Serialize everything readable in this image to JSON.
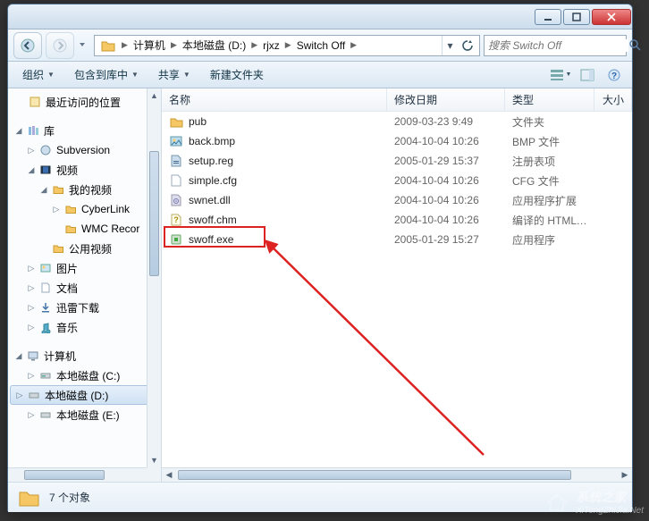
{
  "window": {
    "title": ""
  },
  "nav": {
    "crumbs": [
      "计算机",
      "本地磁盘 (D:)",
      "rjxz",
      "Switch Off"
    ],
    "search_placeholder": "搜索 Switch Off"
  },
  "toolbar": {
    "organize": "组织",
    "include": "包含到库中",
    "share": "共享",
    "newfolder": "新建文件夹"
  },
  "columns": {
    "name": "名称",
    "date": "修改日期",
    "type": "类型",
    "size": "大小"
  },
  "tree": {
    "recent": "最近访问的位置",
    "libraries": "库",
    "subversion": "Subversion",
    "video": "视频",
    "myvideo": "我的视频",
    "cyberlink": "CyberLink",
    "wmc": "WMC Recor",
    "publicvideo": "公用视频",
    "pictures": "图片",
    "documents": "文档",
    "xunlei": "迅雷下载",
    "music": "音乐",
    "computer": "计算机",
    "drive_c": "本地磁盘 (C:)",
    "drive_d": "本地磁盘 (D:)",
    "drive_e": "本地磁盘 (E:)"
  },
  "files": [
    {
      "name": "pub",
      "date": "2009-03-23 9:49",
      "type": "文件夹",
      "icon": "folder"
    },
    {
      "name": "back.bmp",
      "date": "2004-10-04 10:26",
      "type": "BMP 文件",
      "icon": "img"
    },
    {
      "name": "setup.reg",
      "date": "2005-01-29 15:37",
      "type": "注册表项",
      "icon": "reg"
    },
    {
      "name": "simple.cfg",
      "date": "2004-10-04 10:26",
      "type": "CFG 文件",
      "icon": "file"
    },
    {
      "name": "swnet.dll",
      "date": "2004-10-04 10:26",
      "type": "应用程序扩展",
      "icon": "dll"
    },
    {
      "name": "swoff.chm",
      "date": "2004-10-04 10:26",
      "type": "编译的 HTML 帮...",
      "icon": "chm"
    },
    {
      "name": "swoff.exe",
      "date": "2005-01-29 15:27",
      "type": "应用程序",
      "icon": "exe"
    }
  ],
  "status": {
    "text": "7 个对象"
  },
  "watermark": {
    "text": "系统之家",
    "sub": "XiTongZhiJia.Net"
  }
}
